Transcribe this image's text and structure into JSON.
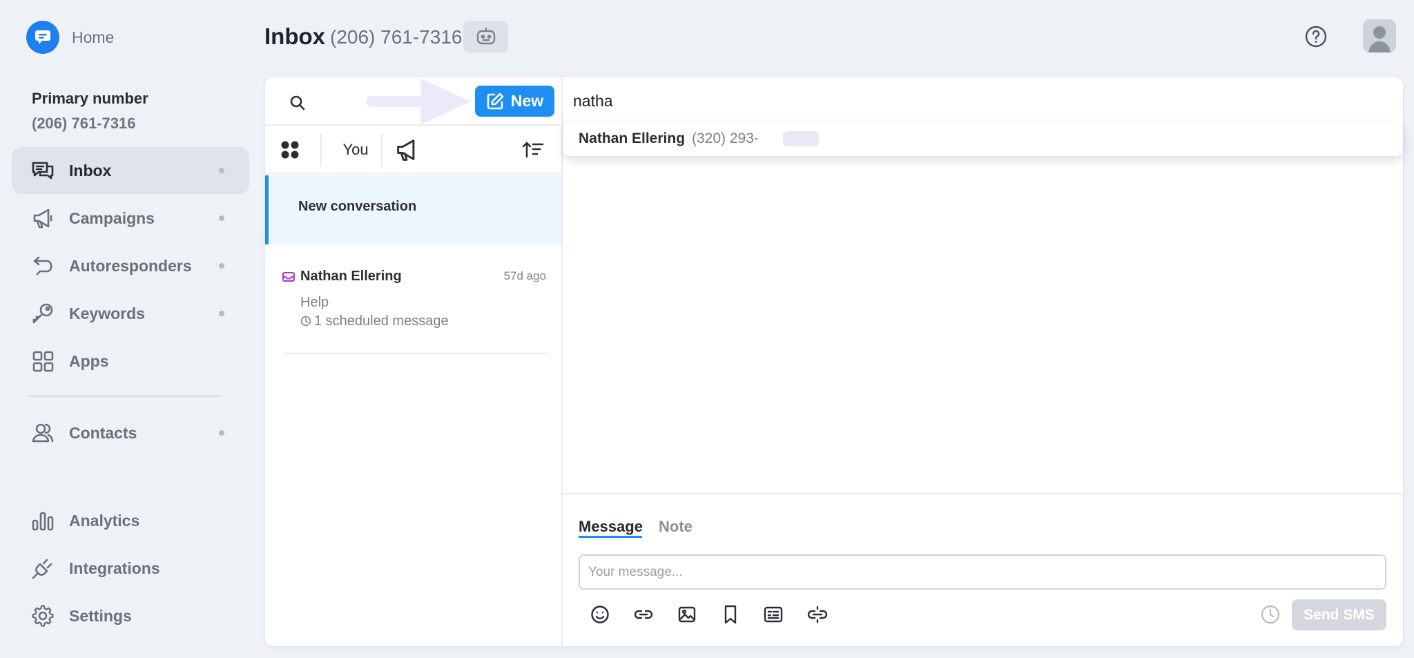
{
  "home": {
    "label": "Home"
  },
  "primary": {
    "title": "Primary number",
    "number": "(206) 761-7316"
  },
  "nav": {
    "items": [
      {
        "label": "Inbox",
        "icon": "chat-bubbles-icon"
      },
      {
        "label": "Campaigns",
        "icon": "megaphone-icon"
      },
      {
        "label": "Autoresponders",
        "icon": "auto-reply-icon"
      },
      {
        "label": "Keywords",
        "icon": "key-icon"
      },
      {
        "label": "Apps",
        "icon": "grid-icon"
      },
      {
        "label": "Contacts",
        "icon": "contacts-icon"
      },
      {
        "label": "Analytics",
        "icon": "bar-chart-icon"
      },
      {
        "label": "Integrations",
        "icon": "plug-icon"
      },
      {
        "label": "Settings",
        "icon": "gear-icon"
      }
    ]
  },
  "header": {
    "title": "Inbox",
    "number": "(206) 761-7316"
  },
  "list": {
    "new_button": "New",
    "filter_you": "You",
    "new_conversation": "New conversation",
    "conversations": [
      {
        "name": "Nathan Ellering",
        "time": "57d ago",
        "last_message": "Help",
        "scheduled": "1 scheduled message"
      }
    ]
  },
  "compose": {
    "to_value": "natha",
    "suggestion": {
      "name": "Nathan Ellering",
      "phone": "(320) 293-"
    },
    "tabs": [
      "Message",
      "Note"
    ],
    "placeholder": "Your message...",
    "send_label": "Send SMS"
  },
  "colors": {
    "accent": "#1e8ff0",
    "brand": "#1e7ff0",
    "background": "#eef1f6"
  }
}
